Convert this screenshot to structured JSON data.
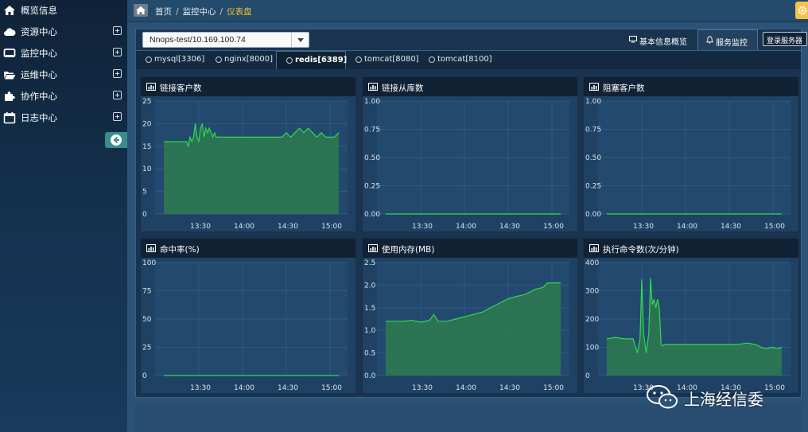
{
  "sidebar": {
    "items": [
      {
        "label": "概览信息",
        "icon": "home-icon",
        "expandable": false
      },
      {
        "label": "资源中心",
        "icon": "cloud-icon",
        "expandable": true
      },
      {
        "label": "监控中心",
        "icon": "monitor-icon",
        "expandable": true
      },
      {
        "label": "运维中心",
        "icon": "folder-icon",
        "expandable": true
      },
      {
        "label": "协作中心",
        "icon": "puzzle-icon",
        "expandable": true
      },
      {
        "label": "日志中心",
        "icon": "calendar-icon",
        "expandable": true
      }
    ],
    "collapse_icon": "arrow-left-icon"
  },
  "breadcrumb": {
    "items": [
      "首页",
      "监控中心",
      "仪表盘"
    ],
    "separator": "/",
    "current_color": "#f0c030"
  },
  "host_select": {
    "value": "Nnops-test/10.169.100.74"
  },
  "top_tabs": {
    "basic": "基本信息概览",
    "service": "服务监控",
    "login": "登录服务器"
  },
  "service_tabs": [
    {
      "label": "mysql[3306]",
      "active": false
    },
    {
      "label": "nginx[8000]",
      "active": false
    },
    {
      "label": "redis[6389]",
      "active": true
    },
    {
      "label": "tomcat[8080]",
      "active": false
    },
    {
      "label": "tomcat[8100]",
      "active": false
    }
  ],
  "watermark": {
    "text": "上海经信委"
  },
  "colors": {
    "line": "#2edb4f",
    "fill": "#2d7a4e",
    "bg": "#1f4264"
  },
  "chart_data": [
    {
      "type": "area",
      "title": "链接客户数",
      "yticks": [
        "25",
        "20",
        "15",
        "10",
        "5",
        "0"
      ],
      "ylim": [
        0,
        25
      ],
      "xticks": [
        "13:30",
        "14:00",
        "14:30",
        "15:00"
      ],
      "x": [
        13.1,
        13.25,
        13.33,
        13.34,
        13.36,
        13.38,
        13.4,
        13.42,
        13.44,
        13.46,
        13.48,
        13.5,
        13.52,
        13.54,
        13.56,
        13.58,
        13.6,
        13.62,
        13.64,
        13.66,
        13.68,
        13.7,
        13.72,
        13.74,
        13.76,
        13.8,
        13.85,
        13.9,
        13.95,
        14.0,
        14.05,
        14.1,
        14.15,
        14.2,
        14.25,
        14.3,
        14.35,
        14.4,
        14.45,
        14.5,
        14.55,
        14.6,
        14.65,
        14.7,
        14.75,
        14.8,
        14.85,
        14.9,
        14.95,
        15.0,
        15.05,
        15.1
      ],
      "values": [
        16,
        16,
        16,
        16,
        16,
        15,
        17,
        16,
        17,
        20,
        17,
        16,
        19,
        20,
        17,
        19,
        18,
        19,
        18,
        17,
        18,
        17,
        17,
        17,
        17,
        17,
        17,
        17,
        17,
        17,
        17,
        17,
        17,
        17,
        17,
        17,
        17,
        17,
        17,
        18,
        17,
        18,
        19,
        18,
        19,
        18,
        17,
        18,
        17,
        17,
        17,
        18
      ]
    },
    {
      "type": "area",
      "title": "链接从库数",
      "yticks": [
        "1.00",
        "0.50",
        "0.25",
        "0.00"
      ],
      "ylim": [
        0,
        1
      ],
      "tick_values": [
        1.0,
        0.75,
        0.5,
        0.25,
        0.0
      ],
      "tick_labels": [
        "1.00",
        "0.75",
        "0.50",
        "0.25",
        "0.00"
      ],
      "xticks": [
        "13:30",
        "14:00",
        "14:30",
        "15:00"
      ],
      "x": [
        13.1,
        15.1
      ],
      "values": [
        0,
        0
      ]
    },
    {
      "type": "area",
      "title": "阻塞客户数",
      "ylim": [
        0,
        1
      ],
      "tick_values": [
        1.0,
        0.75,
        0.5,
        0.25,
        0.0
      ],
      "tick_labels": [
        "1.00",
        "0.75",
        "0.50",
        "0.25",
        "0.00"
      ],
      "xticks": [
        "13:30",
        "14:00",
        "14:30",
        "15:00"
      ],
      "x": [
        13.1,
        15.1
      ],
      "values": [
        0,
        0
      ]
    },
    {
      "type": "area",
      "title": "命中率(%)",
      "ylim": [
        0,
        100
      ],
      "tick_values": [
        100,
        75,
        50,
        25,
        0
      ],
      "tick_labels": [
        "100",
        "75",
        "50",
        "25",
        "0"
      ],
      "xticks": [
        "13:30",
        "14:00",
        "14:30",
        "15:00"
      ],
      "x": [
        13.1,
        15.1
      ],
      "values": [
        0,
        0
      ]
    },
    {
      "type": "area",
      "title": "使用内存(MB)",
      "ylim": [
        0,
        2.5
      ],
      "tick_values": [
        2.5,
        2.0,
        1.5,
        1.0,
        0.5,
        0.0
      ],
      "tick_labels": [
        "2.5",
        "2.0",
        "1.5",
        "1.0",
        "0.5",
        "0.0"
      ],
      "xticks": [
        "13:30",
        "14:00",
        "14:30",
        "15:00"
      ],
      "x": [
        13.1,
        13.2,
        13.3,
        13.4,
        13.5,
        13.6,
        13.65,
        13.7,
        13.8,
        13.9,
        14.0,
        14.1,
        14.2,
        14.3,
        14.4,
        14.5,
        14.6,
        14.7,
        14.75,
        14.8,
        14.9,
        14.95,
        15.0,
        15.05,
        15.1
      ],
      "values": [
        1.2,
        1.2,
        1.2,
        1.22,
        1.18,
        1.22,
        1.35,
        1.2,
        1.2,
        1.25,
        1.3,
        1.35,
        1.4,
        1.5,
        1.6,
        1.7,
        1.75,
        1.8,
        1.85,
        1.9,
        1.95,
        2.05,
        2.05,
        2.05,
        2.05
      ]
    },
    {
      "type": "area",
      "title": "执行命令数(次/分钟)",
      "ylim": [
        0,
        400
      ],
      "tick_values": [
        400,
        300,
        200,
        100,
        0
      ],
      "tick_labels": [
        "400",
        "300",
        "200",
        "100",
        "0"
      ],
      "xticks": [
        "13:30",
        "14:00",
        "14:30",
        "15:00"
      ],
      "x": [
        13.1,
        13.2,
        13.3,
        13.4,
        13.45,
        13.48,
        13.5,
        13.52,
        13.55,
        13.58,
        13.6,
        13.62,
        13.64,
        13.66,
        13.68,
        13.7,
        13.72,
        13.74,
        13.76,
        13.8,
        13.9,
        14.0,
        14.1,
        14.2,
        14.3,
        14.4,
        14.5,
        14.6,
        14.7,
        14.8,
        14.9,
        15.0,
        15.05,
        15.1
      ],
      "values": [
        130,
        135,
        130,
        130,
        80,
        130,
        340,
        150,
        80,
        150,
        345,
        250,
        270,
        240,
        270,
        240,
        110,
        105,
        110,
        110,
        110,
        110,
        110,
        110,
        110,
        110,
        110,
        110,
        115,
        110,
        95,
        100,
        95,
        100
      ]
    }
  ]
}
